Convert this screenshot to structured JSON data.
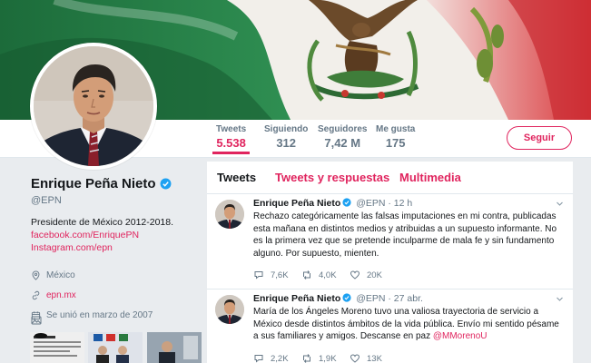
{
  "colors": {
    "accent": "#e0245e",
    "text": "#14171a",
    "muted": "#657786",
    "verified": "#1da1f2"
  },
  "stats": [
    {
      "label": "Tweets",
      "value": "5.538",
      "active": true
    },
    {
      "label": "Siguiendo",
      "value": "312"
    },
    {
      "label": "Seguidores",
      "value": "7,42 M"
    },
    {
      "label": "Me gusta",
      "value": "175"
    }
  ],
  "follow_label": "Seguir",
  "profile": {
    "name": "Enrique Peña Nieto",
    "handle": "@EPN",
    "bio": "Presidente de México 2012-2018.",
    "links": [
      "facebook.com/EnriquePN",
      "Instagram.com/epn"
    ],
    "location": "México",
    "website": "epn.mx",
    "joined": "Se unió en marzo de 2007"
  },
  "tabs": [
    "Tweets",
    "Tweets y respuestas",
    "Multimedia"
  ],
  "tweets": [
    {
      "name": "Enrique Peña Nieto",
      "handle": "@EPN",
      "time": "· 12 h",
      "text": "Rechazo categóricamente las falsas imputaciones en mi contra, publicadas esta mañana en distintos medios y atribuidas a un supuesto informante. No es la primera vez que se pretende inculparme de mala fe y sin fundamento alguno. Por supuesto, mienten.",
      "mention": "",
      "replies": "7,6K",
      "retweets": "4,0K",
      "likes": "20K"
    },
    {
      "name": "Enrique Peña Nieto",
      "handle": "@EPN",
      "time": "· 27 abr.",
      "text": "María de los Ángeles Moreno tuvo una valiosa trayectoria de servicio a México desde distintos ámbitos de la vida pública. Envío mi sentido pésame a sus familiares y amigos. Descanse en paz ",
      "mention": "@MMorenoU",
      "replies": "2,2K",
      "retweets": "1,9K",
      "likes": "13K"
    }
  ]
}
